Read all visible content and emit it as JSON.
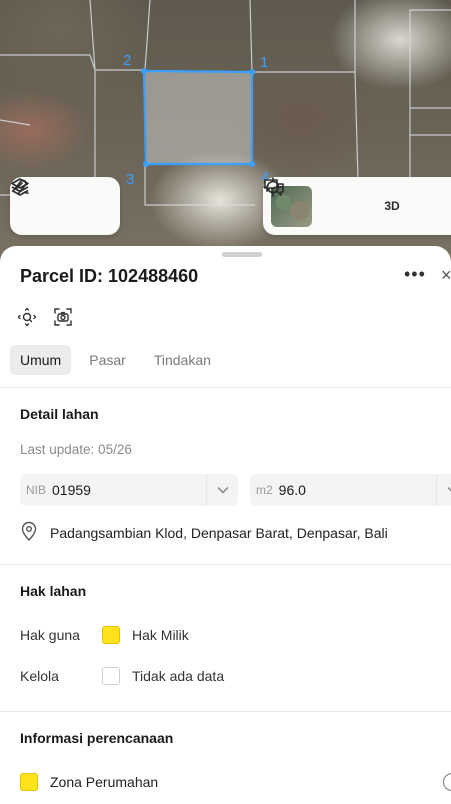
{
  "map": {
    "vertex_labels": [
      "1",
      "2",
      "3",
      "4"
    ],
    "left_tools": [
      {
        "icon": "layers-icon"
      },
      {
        "icon": "measure-icon"
      }
    ],
    "right_tools": {
      "basemap_icon": "satellite-thumbnail",
      "locate_icon": "crosshair-icon",
      "three_d_label": "3D",
      "feedback_icon": "chat-icon"
    },
    "parcel_color": "#3aa0ff"
  },
  "sheet": {
    "title": "Parcel ID: 102488460",
    "more_label": "•••",
    "close_label": "×",
    "tabs": [
      {
        "label": "Umum",
        "active": true
      },
      {
        "label": "Pasar",
        "active": false
      },
      {
        "label": "Tindakan",
        "active": false
      }
    ],
    "detail": {
      "heading": "Detail lahan",
      "last_update": "Last update: 05/26",
      "nib_label": "NIB",
      "nib_value": "01959",
      "area_label": "m2",
      "area_value": "96.0",
      "address": "Padangsambian Klod, Denpasar Barat, Denpasar, Bali"
    },
    "hak": {
      "heading": "Hak lahan",
      "rows": [
        {
          "key": "Hak guna",
          "value": "Hak Milik",
          "swatch": "#ffe21a"
        },
        {
          "key": "Kelola",
          "value": "Tidak ada data",
          "swatch": "#ffffff"
        }
      ]
    },
    "planning": {
      "heading": "Informasi perencanaan",
      "zone": "Zona Perumahan",
      "zone_color": "#ffe21a"
    }
  }
}
